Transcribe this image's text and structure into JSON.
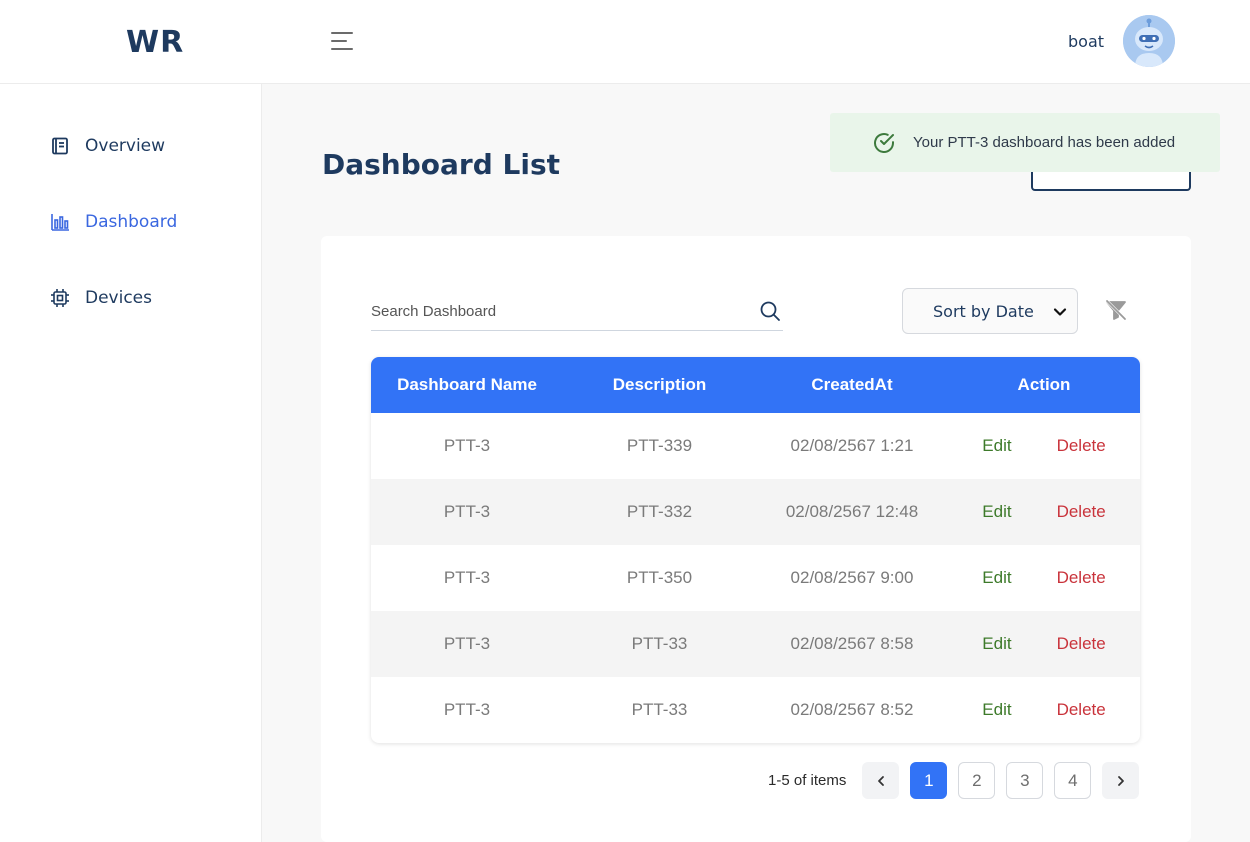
{
  "app": {
    "logo": "WR"
  },
  "header": {
    "menu_icon": "hamburger-icon",
    "username": "boat",
    "avatar_icon": "robot-avatar"
  },
  "sidebar": {
    "items": [
      {
        "label": "Overview",
        "icon": "document-icon",
        "active": false
      },
      {
        "label": "Dashboard",
        "icon": "bar-chart-icon",
        "active": true
      },
      {
        "label": "Devices",
        "icon": "chip-icon",
        "active": false
      }
    ]
  },
  "main": {
    "title": "Dashboard List"
  },
  "toast": {
    "message": "Your PTT-3 dashboard has been added",
    "icon": "check-circle-icon",
    "color": "#3d7a3d"
  },
  "search": {
    "placeholder": "Search Dashboard",
    "value": "",
    "icon": "search-icon"
  },
  "sort": {
    "selected": "Sort by Date",
    "icon": "chevron-down-icon"
  },
  "filter_clear_icon": "filter-off-icon",
  "table": {
    "headers": [
      "Dashboard Name",
      "Description",
      "CreatedAt",
      "Action"
    ],
    "rows": [
      {
        "name": "PTT-3",
        "description": "PTT-339",
        "created": "02/08/2567 1:21",
        "edit": "Edit",
        "delete": "Delete"
      },
      {
        "name": "PTT-3",
        "description": "PTT-332",
        "created": "02/08/2567 12:48",
        "edit": "Edit",
        "delete": "Delete"
      },
      {
        "name": "PTT-3",
        "description": "PTT-350",
        "created": "02/08/2567 9:00",
        "edit": "Edit",
        "delete": "Delete"
      },
      {
        "name": "PTT-3",
        "description": "PTT-33",
        "created": "02/08/2567 8:58",
        "edit": "Edit",
        "delete": "Delete"
      },
      {
        "name": "PTT-3",
        "description": "PTT-33",
        "created": "02/08/2567 8:52",
        "edit": "Edit",
        "delete": "Delete"
      }
    ]
  },
  "pagination": {
    "info": "1-5 of items",
    "pages": [
      "1",
      "2",
      "3",
      "4"
    ],
    "current": "1"
  },
  "colors": {
    "primary": "#3273f6",
    "navy": "#1e3a5f",
    "edit": "#3d7a2a",
    "delete": "#c9333b",
    "toast_bg": "#e9f5ea"
  }
}
